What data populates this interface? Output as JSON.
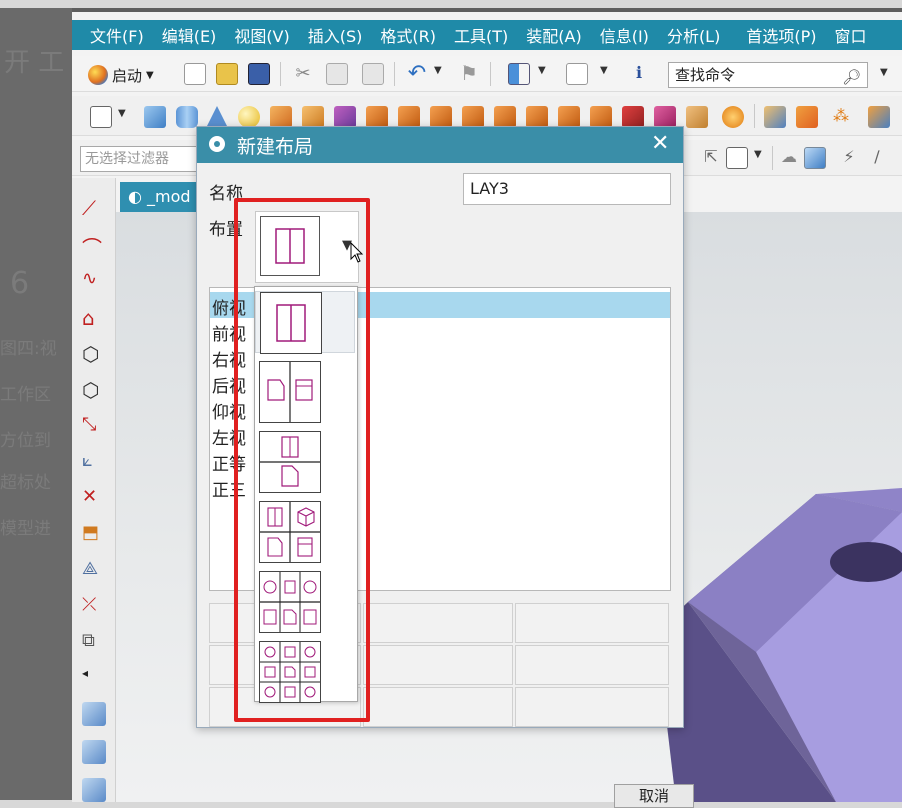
{
  "background_ghost_text": [
    "6",
    "图四:视",
    "工作区",
    "方位到",
    "超标处",
    "模型进"
  ],
  "menubar": {
    "items": [
      "文件(F)",
      "编辑(E)",
      "视图(V)",
      "插入(S)",
      "格式(R)",
      "工具(T)",
      "装配(A)",
      "信息(I)",
      "分析(L)",
      "首选项(P)",
      "窗口"
    ]
  },
  "toolbar": {
    "start_label": "启动",
    "command_search_value": "查找命令",
    "filter_value": "无选择过滤器"
  },
  "model_tab": {
    "label": "_mod"
  },
  "dialog": {
    "title": "新建布局",
    "name_label": "名称",
    "name_value": "LAY3",
    "layout_label": "布置",
    "views": [
      "俯视",
      "前视",
      "右视",
      "后视",
      "仰视",
      "左视",
      "正等",
      "正三"
    ],
    "selected_view": "俯视",
    "cancel_label": "取消"
  },
  "layout_dropdown": {
    "options": [
      "L1",
      "L2",
      "L3",
      "L4",
      "L6",
      "L9"
    ],
    "selected": "L2"
  },
  "colors": {
    "menubar": "#1f8aa8",
    "dialog_titlebar": "#3a8ea8",
    "selection": "#a8d8ee",
    "highlight_box": "#e02020",
    "model": "#8f84c8"
  },
  "icons": [
    "start-orb-icon",
    "new-file-icon",
    "open-folder-icon",
    "save-icon",
    "cut-icon",
    "copy-icon",
    "paste-icon",
    "undo-icon",
    "redo-icon",
    "grid-icon",
    "info-icon",
    "search-icon",
    "close-icon",
    "gear-icon",
    "dropdown-arrow-icon",
    "cursor-icon"
  ]
}
